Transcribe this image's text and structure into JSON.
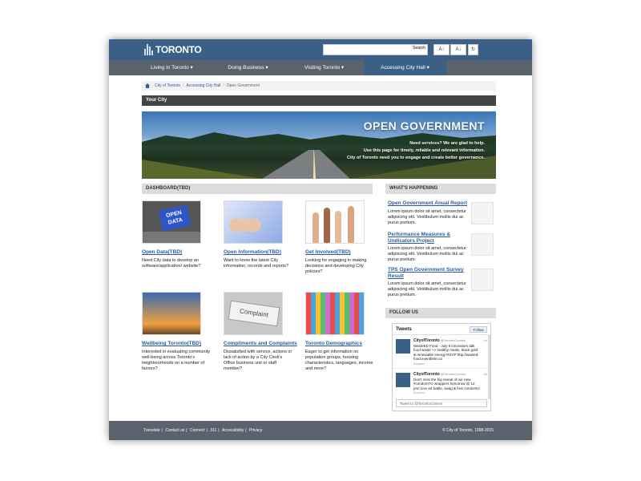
{
  "header": {
    "logo_text": "TORONTO",
    "search": {
      "placeholder": "",
      "button_label": "Search"
    },
    "tools": {
      "increase_text": "A↑",
      "decrease_text": "A↓",
      "refresh": "↻"
    }
  },
  "nav": {
    "items": [
      {
        "label": "Living In Toronto ▾"
      },
      {
        "label": "Doing Business ▾"
      },
      {
        "label": "Visiting Toronto ▾"
      },
      {
        "label": "Accessing City Hall ▾"
      }
    ]
  },
  "breadcrumb": {
    "items": [
      "City of Toronto",
      "Accessing City Hall",
      "Open Government"
    ],
    "separator": "/"
  },
  "section_bar": {
    "title": "Your City"
  },
  "banner": {
    "title": "OPEN GOVERNMENT",
    "lines": [
      "Need services? We are glad to help.",
      "Use this page for timely, reliable and relevant information.",
      "City of Toronto need you to engage and create better governance."
    ]
  },
  "dashboard": {
    "heading": "DASHBOARD(TBD)",
    "tiles": [
      {
        "title": "Open Data(TBD)",
        "desc": "Need City data to develop an software/application/ website?",
        "image_text": "OPEN DATA"
      },
      {
        "title": "Open Information(TBD)",
        "desc": "Want to know the latest City information, records and reports?"
      },
      {
        "title": "Get Involved(TBD)",
        "desc": "Looking for engaging in making decisions and developing City policies?"
      },
      {
        "title": "Wellbeing Toronto(TBD)",
        "desc": "Interested in evaluating community well-being across Toronto's neighbourhoods on a number of factors?"
      },
      {
        "title": "Compliments and Complaints",
        "desc": "Dissatisfied with service, actions or lack of action by a City Clerk's Office business unit or staff member?",
        "image_text": "Complaint"
      },
      {
        "title": "Toronto Demographics",
        "desc": "Eager to get information on population groups, housing characteristics, languages, income and more?"
      }
    ]
  },
  "whats_happening": {
    "heading": "WHAT'S HAPPENING",
    "items": [
      {
        "title": "Open Government Anual Report",
        "desc": "Lorem ipsum dolor sit amet, consectetur adipiscing elit. Vestibulum mollis dui ac purus pretium."
      },
      {
        "title": "Performance Measures & Undicators Project",
        "desc": "Lorem ipsum dolor sit amet, consectetur adipiscing elit. Vestibulum mollis dui ac purus pretium."
      },
      {
        "title": "TPS Open Government Survey Result",
        "desc": "Lorem ipsum dolor sit amet, consectetur adipiscing elit. Vestibulum mollis dui ac purus pretium."
      }
    ]
  },
  "follow_us": {
    "heading": "FOLLOW US",
    "twitter": {
      "title": "Tweets",
      "follow_label": "Follow",
      "tweets": [
        {
          "name": "CityofToronto",
          "handle": "@TorontoComms",
          "time": "6h",
          "text": "WasteED Food - July 9 innovators talk food waste >> healthy meals, black gold & renewable energy RSVP http://wasted-food.eventbrite.ca",
          "expand": "Expand"
        },
        {
          "name": "CityofToronto",
          "handle": "@TorontoComms",
          "time": "8h",
          "text": "Don't miss the big reveal of our new #condomTO wrappers tomorrow @ 12 pm! Live art battle, swag & free condoms!",
          "expand": "Expand"
        }
      ],
      "input_placeholder": "Tweet to @TorontoComms"
    }
  },
  "footer": {
    "links": [
      "Translate",
      "Contact us",
      "Connect",
      "311",
      "Accessibility",
      "Privacy"
    ],
    "copyright": "© City of Toronto, 1998-2015"
  }
}
